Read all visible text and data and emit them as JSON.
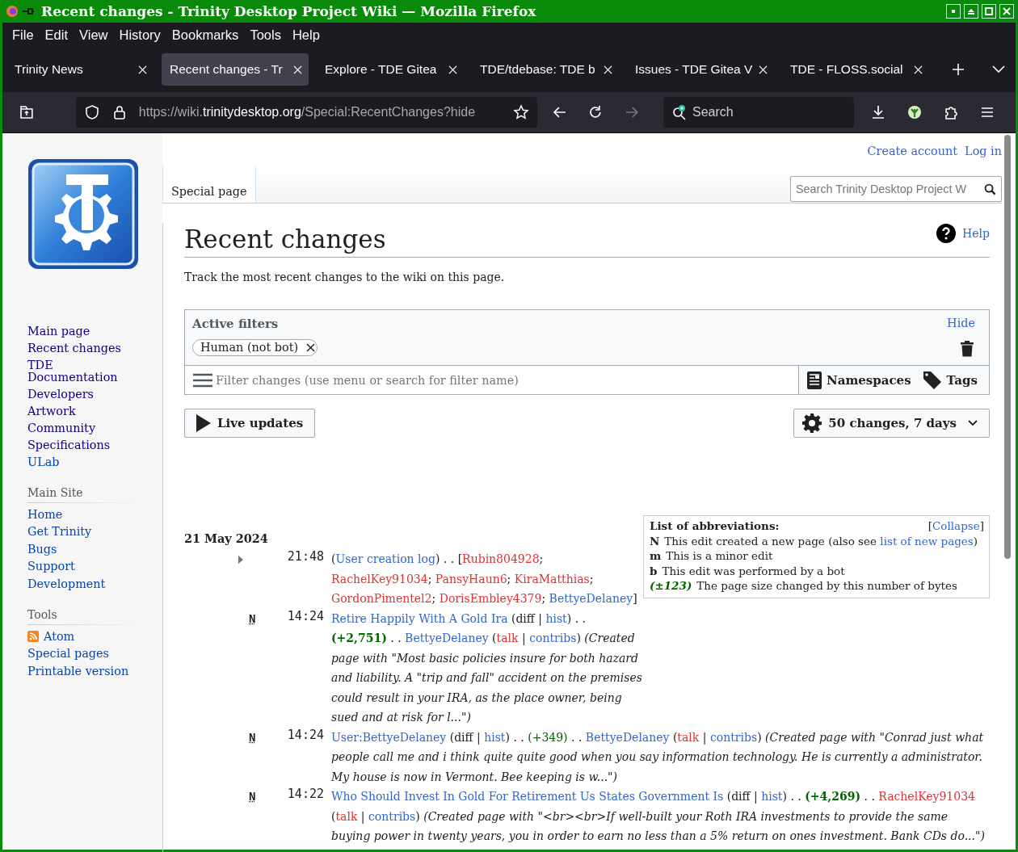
{
  "window": {
    "title": "Recent changes - Trinity Desktop Project Wiki — Mozilla Firefox"
  },
  "menu": [
    "File",
    "Edit",
    "View",
    "History",
    "Bookmarks",
    "Tools",
    "Help"
  ],
  "tabs": [
    {
      "label": "Trinity News",
      "selected": false
    },
    {
      "label": "Recent changes - Tr",
      "selected": true
    },
    {
      "label": "Explore - TDE Gitea",
      "selected": false
    },
    {
      "label": "TDE/tdebase: TDE b",
      "selected": false
    },
    {
      "label": "Issues - TDE Gitea V",
      "selected": false
    },
    {
      "label": "TDE - FLOSS.social",
      "selected": false
    }
  ],
  "toolbar": {
    "url": {
      "prefix": "https://wiki.",
      "host": "trinitydesktop.org",
      "path": "/Special:RecentChanges?hide"
    },
    "search_placeholder": "Search"
  },
  "personal": [
    "Create account",
    "Log in"
  ],
  "namespace_tab": {
    "label": "Special page",
    "selected": true
  },
  "wiki_search": {
    "placeholder": "Search Trinity Desktop Project W"
  },
  "sidebar": {
    "nav": [
      {
        "label": "Main page",
        "visited": true
      },
      {
        "label": "Recent changes",
        "visited": true
      },
      {
        "label": "TDE Documentation",
        "visited": true
      },
      {
        "label": "Developers",
        "visited": true
      },
      {
        "label": "Artwork",
        "visited": true
      },
      {
        "label": "Community",
        "visited": true
      },
      {
        "label": "Specifications",
        "visited": true
      },
      {
        "label": "ULab",
        "visited": false
      }
    ],
    "sections": [
      {
        "title": "Main Site",
        "items": [
          {
            "label": "Home",
            "kind": "link"
          },
          {
            "label": "Get Trinity",
            "kind": "link"
          },
          {
            "label": "Bugs",
            "kind": "link"
          },
          {
            "label": "Support",
            "kind": "link"
          },
          {
            "label": "Development",
            "kind": "link"
          }
        ]
      },
      {
        "title": "Tools",
        "items": [
          {
            "label": "Atom",
            "kind": "feed"
          },
          {
            "label": "Special pages",
            "kind": "link"
          },
          {
            "label": "Printable version",
            "kind": "link"
          }
        ]
      }
    ]
  },
  "page": {
    "title": "Recent changes",
    "help": "Help",
    "intro": "Track the most recent changes to the wiki on this page."
  },
  "filters": {
    "title": "Active filters",
    "hide": "Hide",
    "chips": [
      "Human (not bot)"
    ],
    "placeholder": "Filter changes (use menu or search for filter name)",
    "namespaces": "Namespaces",
    "tags": "Tags"
  },
  "live_updates": "Live updates",
  "limit": "50 changes, 7 days",
  "abbreviations": {
    "title": "List of abbreviations:",
    "collapse": {
      "before": "[",
      "link": "Collapse",
      "after": "]"
    },
    "items": [
      {
        "key": "N",
        "kind": "flag",
        "text": "This edit created a new page (also see ",
        "link": "list of new pages",
        "after": ")"
      },
      {
        "key": "m",
        "kind": "flag",
        "text": "This is a minor edit"
      },
      {
        "key": "b",
        "kind": "flag",
        "text": "This edit was performed by a bot"
      },
      {
        "key": "(±123)",
        "kind": "size",
        "text": "The page size changed by this number of bytes"
      }
    ]
  },
  "changes": {
    "date": "21 May 2024",
    "entries": [
      {
        "expanded": false,
        "time": "21:48",
        "segments": [
          {
            "kind": "text",
            "text": "("
          },
          {
            "kind": "link",
            "text": "User creation log"
          },
          {
            "kind": "text",
            "text": ") . . ["
          },
          {
            "kind": "new_link",
            "text": "Rubin804928"
          },
          {
            "kind": "text",
            "text": "; "
          },
          {
            "kind": "new_link",
            "text": "RachelKey91034"
          },
          {
            "kind": "text",
            "text": "; "
          },
          {
            "kind": "new_link",
            "text": "PansyHaun6"
          },
          {
            "kind": "text",
            "text": "; "
          },
          {
            "kind": "new_link",
            "text": "KiraMatthias"
          },
          {
            "kind": "text",
            "text": "; "
          },
          {
            "kind": "new_link",
            "text": "GordonPimentel2"
          },
          {
            "kind": "text",
            "text": "; "
          },
          {
            "kind": "new_link",
            "text": "DorisEmbley4379"
          },
          {
            "kind": "text",
            "text": "; "
          },
          {
            "kind": "link",
            "text": "BettyeDelaney"
          },
          {
            "kind": "text",
            "text": "]"
          }
        ]
      },
      {
        "flag": "N",
        "time": "14:24",
        "segments": [
          {
            "kind": "link",
            "text": "Retire Happily With A Gold Ira"
          },
          {
            "kind": "text",
            "text": " (diff | "
          },
          {
            "kind": "link",
            "text": "hist"
          },
          {
            "kind": "text",
            "text": ") . . "
          },
          {
            "kind": "size_big",
            "text": "(+2,751)"
          },
          {
            "kind": "text",
            "text": " . . "
          },
          {
            "kind": "link",
            "text": "BettyeDelaney"
          },
          {
            "kind": "text",
            "text": " ("
          },
          {
            "kind": "new_link",
            "text": "talk"
          },
          {
            "kind": "text",
            "text": " | "
          },
          {
            "kind": "link",
            "text": "contribs"
          },
          {
            "kind": "text",
            "text": ") "
          },
          {
            "kind": "comment",
            "text": "(Created page with \"Most basic policies insure for both hazard and liability. A \"trip and fall\" accident on the premises could result in your IRA, as the place owner, being sued and at risk for l...\")"
          }
        ]
      },
      {
        "flag": "N",
        "time": "14:24",
        "segments": [
          {
            "kind": "link",
            "text": "User:BettyeDelaney"
          },
          {
            "kind": "text",
            "text": " (diff | "
          },
          {
            "kind": "link",
            "text": "hist"
          },
          {
            "kind": "text",
            "text": ") . . "
          },
          {
            "kind": "size",
            "text": "(+349)"
          },
          {
            "kind": "text",
            "text": " . . "
          },
          {
            "kind": "link",
            "text": "BettyeDelaney"
          },
          {
            "kind": "text",
            "text": " ("
          },
          {
            "kind": "new_link",
            "text": "talk"
          },
          {
            "kind": "text",
            "text": " | "
          },
          {
            "kind": "link",
            "text": "contribs"
          },
          {
            "kind": "text",
            "text": ") "
          },
          {
            "kind": "comment",
            "text": "(Created page with \"Conrad just what people call me and i think quite quite good when you say information technology. He is currently a administrator. My house is now in Vermont. Bee keeping is w...\")"
          }
        ]
      },
      {
        "flag": "N",
        "time": "14:22",
        "segments": [
          {
            "kind": "link",
            "text": "Who Should Invest In Gold For Retirement Us States Government Is"
          },
          {
            "kind": "text",
            "text": " (diff | "
          },
          {
            "kind": "link",
            "text": "hist"
          },
          {
            "kind": "text",
            "text": ") . . "
          },
          {
            "kind": "size_big",
            "text": "(+4,269)"
          },
          {
            "kind": "text",
            "text": " . . "
          },
          {
            "kind": "new_link",
            "text": "RachelKey91034"
          },
          {
            "kind": "text",
            "text": " ("
          },
          {
            "kind": "new_link",
            "text": "talk"
          },
          {
            "kind": "text",
            "text": " | "
          },
          {
            "kind": "link",
            "text": "contribs"
          },
          {
            "kind": "text",
            "text": ") "
          },
          {
            "kind": "comment",
            "text": "(Created page with \"<br><br>If well-built your Roth IRA investments to provide the same buying power in twenty years, you in order to earn no less than a 5% return on ones investment. Bank CDs do...\")"
          }
        ]
      }
    ]
  }
}
